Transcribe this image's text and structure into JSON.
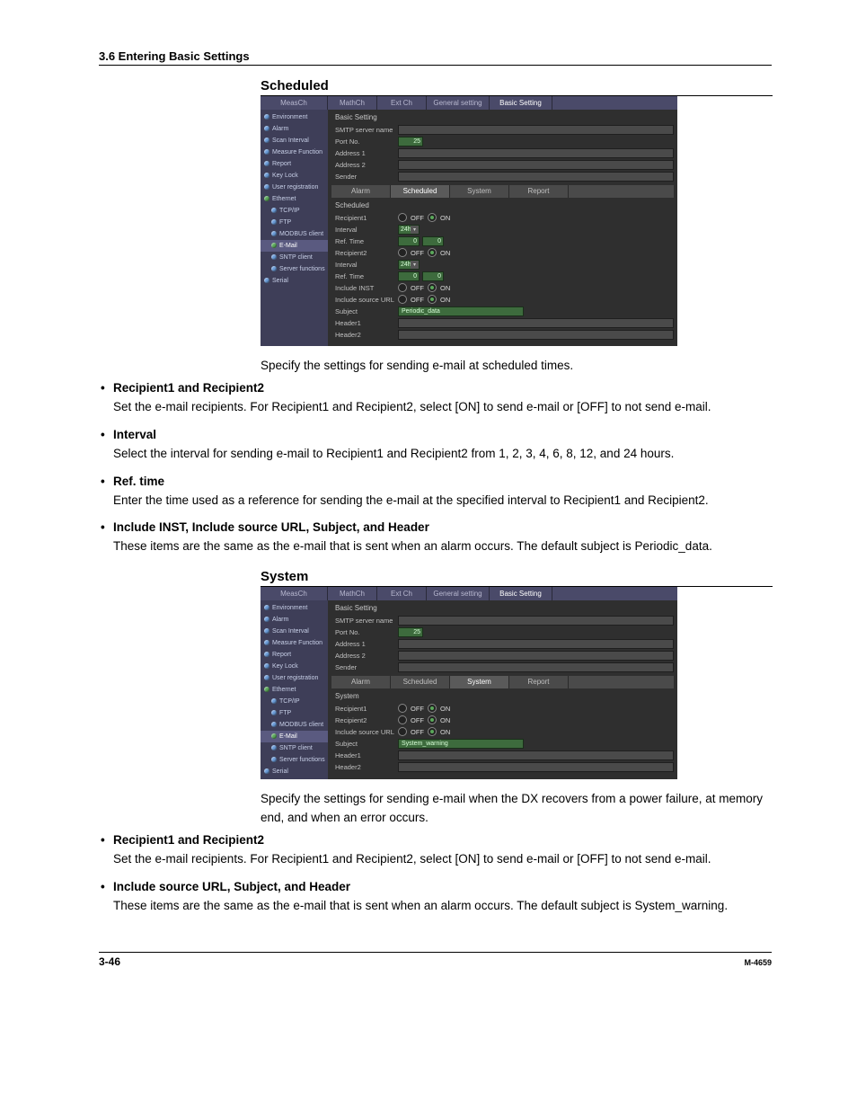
{
  "header": {
    "section_line": "3.6  Entering Basic Settings"
  },
  "scheduled": {
    "title": "Scheduled",
    "top_tabs": [
      "MeasCh",
      "MathCh",
      "Ext Ch",
      "General setting",
      "Basic Setting"
    ],
    "side": {
      "items": [
        "Environment",
        "Alarm",
        "Scan Interval",
        "Measure Function",
        "Report",
        "Key Lock",
        "User registration",
        "Ethernet",
        "TCP/IP",
        "FTP",
        "MODBUS client",
        "E-Mail",
        "SNTP client",
        "Server functions",
        "Serial"
      ]
    },
    "basic": {
      "group": "Basic Setting",
      "rows": {
        "smtp_label": "SMTP server name",
        "smtp_value": "",
        "port_label": "Port No.",
        "port_value": "25",
        "addr1_label": "Address 1",
        "addr1_value": "",
        "addr2_label": "Address 2",
        "addr2_value": "",
        "sender_label": "Sender",
        "sender_value": ""
      }
    },
    "subtabs": [
      "Alarm",
      "Scheduled",
      "System",
      "Report"
    ],
    "form": {
      "group": "Scheduled",
      "recipient1_label": "Recipient1",
      "recipient1_off": "OFF",
      "recipient1_on": "ON",
      "interval1_label": "Interval",
      "interval1_value": "24h",
      "reftime1_label": "Ref. Time",
      "reftime1_h": "0",
      "reftime1_m": "0",
      "recipient2_label": "Recipient2",
      "recipient2_off": "OFF",
      "recipient2_on": "ON",
      "interval2_label": "Interval",
      "interval2_value": "24h",
      "reftime2_label": "Ref. Time",
      "reftime2_h": "0",
      "reftime2_m": "0",
      "inst_label": "Include INST",
      "inst_off": "OFF",
      "inst_on": "ON",
      "url_label": "Include source URL",
      "url_off": "OFF",
      "url_on": "ON",
      "subject_label": "Subject",
      "subject_value": "Periodic_data",
      "header1_label": "Header1",
      "header2_label": "Header2"
    },
    "intro": "Specify the settings for sending e-mail at scheduled times.",
    "bullets": [
      {
        "head": "Recipient1 and Recipient2",
        "body": "Set the e-mail recipients.  For Recipient1 and Recipient2, select [ON] to send e-mail or [OFF] to not send e-mail."
      },
      {
        "head": "Interval",
        "body": "Select the interval for sending e-mail to Recipient1 and Recipient2 from 1, 2, 3, 4, 6, 8, 12, and 24 hours."
      },
      {
        "head": "Ref. time",
        "body": "Enter the time used as a reference for sending the e-mail at the specified interval to Recipient1 and Recipient2."
      },
      {
        "head": "Include INST, Include source URL, Subject, and Header",
        "body": "These items are the same as the e-mail that is sent when an alarm occurs.  The default subject is Periodic_data."
      }
    ]
  },
  "system": {
    "title": "System",
    "top_tabs": [
      "MeasCh",
      "MathCh",
      "Ext Ch",
      "General setting",
      "Basic Setting"
    ],
    "side": {
      "items": [
        "Environment",
        "Alarm",
        "Scan Interval",
        "Measure Function",
        "Report",
        "Key Lock",
        "User registration",
        "Ethernet",
        "TCP/IP",
        "FTP",
        "MODBUS client",
        "E-Mail",
        "SNTP client",
        "Server functions",
        "Serial"
      ]
    },
    "basic": {
      "group": "Basic Setting",
      "rows": {
        "smtp_label": "SMTP server name",
        "smtp_value": "",
        "port_label": "Port No.",
        "port_value": "25",
        "addr1_label": "Address 1",
        "addr1_value": "",
        "addr2_label": "Address 2",
        "addr2_value": "",
        "sender_label": "Sender",
        "sender_value": ""
      }
    },
    "subtabs": [
      "Alarm",
      "Scheduled",
      "System",
      "Report"
    ],
    "form": {
      "group": "System",
      "recipient1_label": "Recipient1",
      "recipient1_off": "OFF",
      "recipient1_on": "ON",
      "recipient2_label": "Recipient2",
      "recipient2_off": "OFF",
      "recipient2_on": "ON",
      "url_label": "Include source URL",
      "url_off": "OFF",
      "url_on": "ON",
      "subject_label": "Subject",
      "subject_value": "System_warning",
      "header1_label": "Header1",
      "header2_label": "Header2"
    },
    "intro": "Specify the settings for sending e-mail when the DX recovers from a power failure, at memory end, and when an error occurs.",
    "bullets": [
      {
        "head": "Recipient1 and Recipient2",
        "body": "Set the e-mail recipients.  For Recipient1 and Recipient2, select [ON] to send e-mail or [OFF] to not send e-mail."
      },
      {
        "head": "Include source URL, Subject, and Header",
        "body": "These items are the same as the e-mail that is sent when an alarm occurs.  The default subject is System_warning."
      }
    ]
  },
  "footer": {
    "left": "3-46",
    "right": "M-4659"
  }
}
